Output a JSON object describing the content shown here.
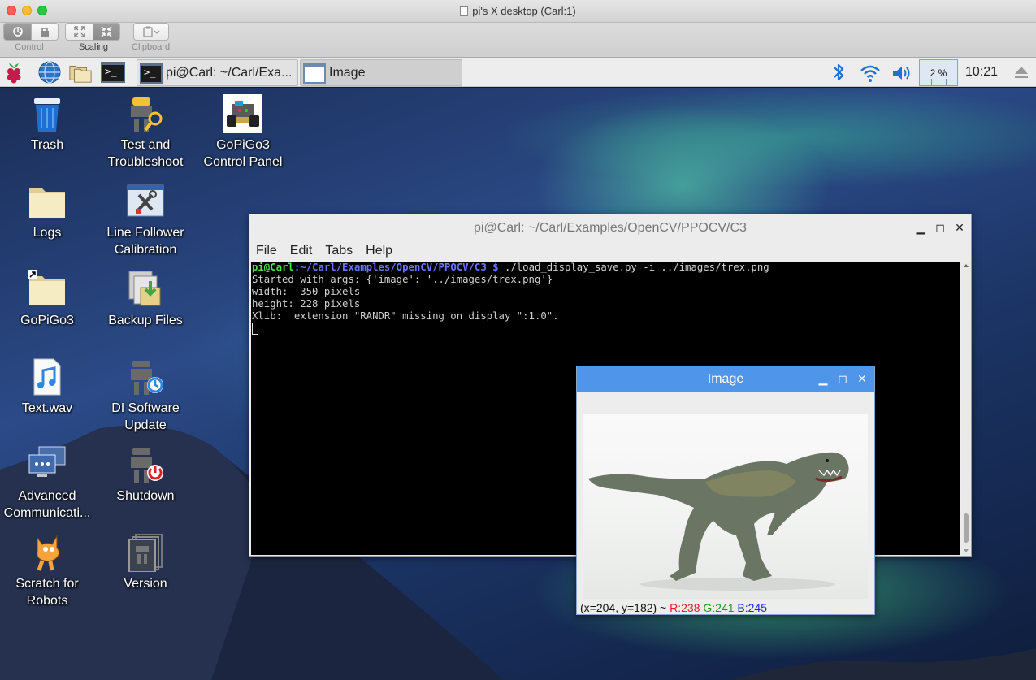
{
  "vnc": {
    "window_title": "pi's X desktop (Carl:1)",
    "toolbar": [
      {
        "label": "Control"
      },
      {
        "label": "Scaling"
      },
      {
        "label": "Clipboard"
      }
    ]
  },
  "panel": {
    "tasks": [
      {
        "label": "pi@Carl: ~/Carl/Exa...",
        "icon": "terminal-icon"
      },
      {
        "label": "Image",
        "icon": "image-window-icon"
      }
    ],
    "cpu": "2 %",
    "clock": "10:21"
  },
  "desktop": {
    "icons": [
      {
        "label1": "Trash",
        "label2": "",
        "icon": "trash-icon"
      },
      {
        "label1": "Test and",
        "label2": "Troubleshoot",
        "icon": "test-troubleshoot-icon"
      },
      {
        "label1": "GoPiGo3",
        "label2": "Control Panel",
        "icon": "gopigo3-robot-icon"
      },
      {
        "label1": "Logs",
        "label2": "",
        "icon": "folder-icon"
      },
      {
        "label1": "Line Follower",
        "label2": "Calibration",
        "icon": "tools-icon"
      },
      {
        "label1": "GoPiGo3",
        "label2": "",
        "icon": "folder-shortcut-icon"
      },
      {
        "label1": "Backup Files",
        "label2": "",
        "icon": "backup-icon"
      },
      {
        "label1": "Text.wav",
        "label2": "",
        "icon": "music-file-icon"
      },
      {
        "label1": "DI Software",
        "label2": "Update",
        "icon": "software-update-icon"
      },
      {
        "label1": "Advanced",
        "label2": "Communicati...",
        "icon": "network-icon"
      },
      {
        "label1": "Shutdown",
        "label2": "",
        "icon": "shutdown-icon"
      },
      {
        "label1": "Scratch for",
        "label2": "Robots",
        "icon": "scratch-cat-icon"
      },
      {
        "label1": "Version",
        "label2": "",
        "icon": "version-icon"
      }
    ]
  },
  "terminal": {
    "title": "pi@Carl: ~/Carl/Examples/OpenCV/PPOCV/C3",
    "menu": [
      "File",
      "Edit",
      "Tabs",
      "Help"
    ],
    "prompt_user": "pi@Carl",
    "prompt_path": ":~/Carl/Examples/OpenCV/PPOCV/C3 $",
    "command": " ./load_display_save.py -i ../images/trex.png",
    "output": [
      "Started with args: {'image': '../images/trex.png'}",
      "width:  350 pixels",
      "height: 228 pixels",
      "Xlib:  extension \"RANDR\" missing on display \":1.0\"."
    ]
  },
  "image_window": {
    "title": "Image",
    "status_prefix": "(x=204, y=182) ~",
    "status_r": "R:238",
    "status_g": "G:241",
    "status_b": "B:245"
  },
  "colors": {
    "image_titlebar": "#4f95ea",
    "prompt_user": "#4ee24e",
    "prompt_path": "#6a74ff"
  }
}
